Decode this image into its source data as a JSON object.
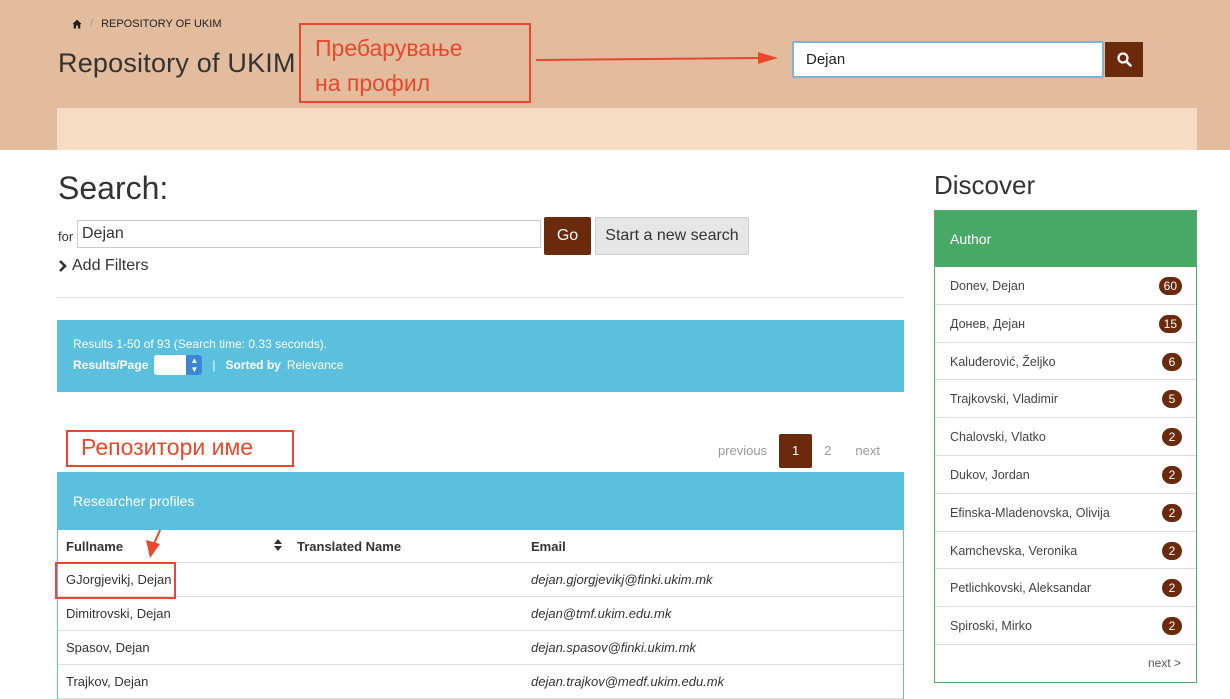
{
  "header": {
    "breadcrumb": "REPOSITORY OF UKIM",
    "title": "Repository of UKIM",
    "search_value": "Dejan"
  },
  "annotations": {
    "profile_search_line1": "Пребарување",
    "profile_search_line2": "на профил",
    "repository_name": "Репозитори име"
  },
  "search": {
    "heading": "Search:",
    "for_label": "for",
    "query": "Dejan",
    "go_label": "Go",
    "new_search_label": "Start a new search",
    "add_filters_label": "Add Filters"
  },
  "results": {
    "summary": "Results 1-50 of 93 (Search time: 0.33 seconds).",
    "results_per_page_label": "Results/Page",
    "separator": "|",
    "sorted_by_label": "Sorted by",
    "sorted_by_value": "Relevance"
  },
  "pagination": {
    "previous": "previous",
    "pages": [
      "1",
      "2"
    ],
    "next": "next"
  },
  "profiles": {
    "heading": "Researcher profiles",
    "columns": [
      "Fullname",
      "Translated Name",
      "Email"
    ],
    "rows": [
      {
        "fullname": "GJorgjevikj, Dejan",
        "translated": "",
        "email": "dejan.gjorgjevikj@finki.ukim.mk"
      },
      {
        "fullname": "Dimitrovski, Dejan",
        "translated": "",
        "email": "dejan@tmf.ukim.edu.mk"
      },
      {
        "fullname": "Spasov, Dejan",
        "translated": "",
        "email": "dejan.spasov@finki.ukim.mk"
      },
      {
        "fullname": "Trajkov, Dejan",
        "translated": "",
        "email": "dejan.trajkov@medf.ukim.edu.mk"
      }
    ]
  },
  "discover": {
    "heading": "Discover",
    "facet_title": "Author",
    "items": [
      {
        "label": "Donev, Dejan",
        "count": "60"
      },
      {
        "label": "Донев, Дејан",
        "count": "15"
      },
      {
        "label": "Kaluđerović, Željko",
        "count": "6"
      },
      {
        "label": "Trajkovski, Vladimir",
        "count": "5"
      },
      {
        "label": "Chalovski, Vlatko",
        "count": "2"
      },
      {
        "label": "Dukov, Jordan",
        "count": "2"
      },
      {
        "label": "Efinska-Mladenovska, Olivija",
        "count": "2"
      },
      {
        "label": "Kamchevska, Veronika",
        "count": "2"
      },
      {
        "label": "Petlichkovski, Aleksandar",
        "count": "2"
      },
      {
        "label": "Spiroski, Mirko",
        "count": "2"
      }
    ],
    "next_label": "next >"
  },
  "colors": {
    "brand_dark": "#6b2a0c",
    "header_bg": "#e3bc9e",
    "info_blue": "#5bc0de",
    "facet_green": "#47a868",
    "annotation_red": "#e8482c"
  },
  "icons": [
    "home-icon",
    "search-icon",
    "chevron-right-icon",
    "sort-icon"
  ]
}
